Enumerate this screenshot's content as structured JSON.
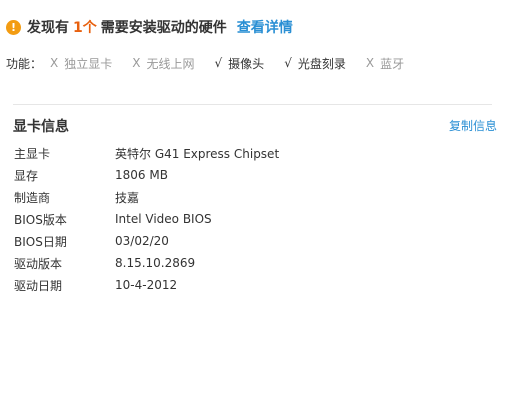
{
  "alert": {
    "prefix": "发现有",
    "count": "1个",
    "suffix": "需要安装驱动的硬件",
    "link": "查看详情"
  },
  "features": {
    "label": "功能：",
    "items": [
      {
        "mark": "X",
        "label": "独立显卡",
        "enabled": false
      },
      {
        "mark": "X",
        "label": "无线上网",
        "enabled": false
      },
      {
        "mark": "√",
        "label": "摄像头",
        "enabled": true
      },
      {
        "mark": "√",
        "label": "光盘刻录",
        "enabled": true
      },
      {
        "mark": "X",
        "label": "蓝牙",
        "enabled": false
      }
    ]
  },
  "section": {
    "title": "显卡信息",
    "copy_label": "复制信息"
  },
  "info": [
    {
      "key": "主显卡",
      "value": "英特尔 G41 Express Chipset"
    },
    {
      "key": "显存",
      "value": "1806 MB"
    },
    {
      "key": "制造商",
      "value": "技嘉"
    },
    {
      "key": "BIOS版本",
      "value": "Intel Video BIOS"
    },
    {
      "key": "BIOS日期",
      "value": "03/02/20"
    },
    {
      "key": "驱动版本",
      "value": "8.15.10.2869"
    },
    {
      "key": "驱动日期",
      "value": "10-4-2012"
    }
  ],
  "colors": {
    "warning": "#f39c12",
    "count": "#e8600e",
    "link": "#2a8fd4",
    "disabled": "#999999",
    "text": "#333333"
  }
}
